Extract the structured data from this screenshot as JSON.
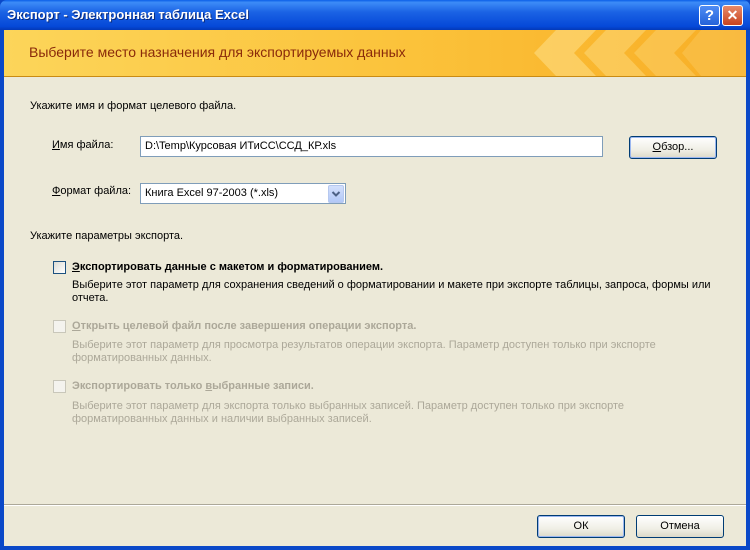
{
  "window": {
    "title": "Экспорт - Электронная таблица Excel",
    "help_glyph": "?",
    "close_glyph": "✕"
  },
  "banner": {
    "text": "Выберите место назначения для экспортируемых данных"
  },
  "file_section": {
    "heading": "Укажите имя и формат целевого файла.",
    "filename_label_prefix": "И",
    "filename_label_rest": "мя файла:",
    "filename_value": "D:\\Temp\\Курсовая ИТиСС\\ССД_КР.xls",
    "browse_label_prefix": "О",
    "browse_label_rest": "бзор...",
    "format_label_prefix": "Ф",
    "format_label_rest": "ормат файла:",
    "format_value": "Книга Excel 97-2003 (*.xls)"
  },
  "export_options": {
    "heading": "Укажите параметры экспорта.",
    "options": [
      {
        "label_prefix": "Э",
        "label_rest": "кспортировать данные с макетом и форматированием.",
        "description": "Выберите этот параметр для сохранения сведений о форматировании и макете при экспорте таблицы, запроса, формы или отчета.",
        "checked": false,
        "enabled": true
      },
      {
        "label_prefix": "О",
        "label_rest": "ткрыть целевой файл после завершения операции экспорта.",
        "description": "Выберите этот параметр для просмотра результатов операции экспорта. Параметр доступен только при экспорте форматированных данных.",
        "checked": false,
        "enabled": false
      },
      {
        "label_pre": "Экспортировать только ",
        "label_prefix": "в",
        "label_rest": "ыбранные записи.",
        "description": "Выберите этот параметр для экспорта только выбранных записей. Параметр доступен только при экспорте форматированных данных и наличии выбранных записей.",
        "checked": false,
        "enabled": false
      }
    ]
  },
  "footer": {
    "ok_label": "ОК",
    "cancel_label": "Отмена"
  },
  "colors": {
    "titlebar": "#0548d8",
    "banner": "#fbc23a",
    "banner_text": "#8a2a0a",
    "dialog_bg": "#ece9d8"
  }
}
